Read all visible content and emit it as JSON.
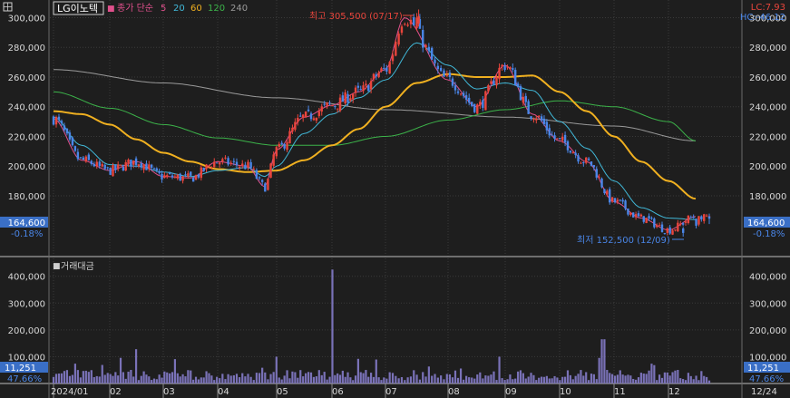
{
  "header": {
    "stock_name": "LG이노텍",
    "ma_label": "종가 단순",
    "ma_periods": [
      {
        "label": "5",
        "color": "#e0508c"
      },
      {
        "label": "20",
        "color": "#41b8d8"
      },
      {
        "label": "60",
        "color": "#f0b020"
      },
      {
        "label": "120",
        "color": "#3cb34a"
      },
      {
        "label": "240",
        "color": "#9a9a9a"
      }
    ],
    "lc": "LC:7.93",
    "hc": "HC:-46.12"
  },
  "price_panel": {
    "current_price": "164,600",
    "change_pct": "-0.18%",
    "high_annotation": "최고 305,500 (07/17)",
    "low_annotation": "최저 152,500 (12/09)"
  },
  "volume_panel": {
    "label": "거래대금",
    "current_value": "11,251",
    "change_pct": "47.66%"
  },
  "colors": {
    "background": "#1e1e1e",
    "up": "#e8453c",
    "down": "#4a86e8",
    "volume_bar": "#7a72b8",
    "badge": "#3a6fc6"
  },
  "chart_data": [
    {
      "type": "line",
      "title": "LG이노텍",
      "x_labels": [
        "2024/01",
        "02",
        "03",
        "04",
        "05",
        "06",
        "07",
        "08",
        "09",
        "10",
        "11",
        "12",
        "12/24"
      ],
      "y_ticks": [
        180000,
        200000,
        220000,
        240000,
        260000,
        280000,
        300000
      ],
      "ylim": [
        147000,
        307000
      ],
      "close_anchors": [
        {
          "x": "2024/01",
          "y": 234000
        },
        {
          "x": "01-mid",
          "y": 210000
        },
        {
          "x": "02",
          "y": 195000
        },
        {
          "x": "02-mid",
          "y": 204000
        },
        {
          "x": "03",
          "y": 192000
        },
        {
          "x": "03-mid",
          "y": 191000
        },
        {
          "x": "04",
          "y": 205000
        },
        {
          "x": "04-mid",
          "y": 199000
        },
        {
          "x": "04-end",
          "y": 184000
        },
        {
          "x": "05",
          "y": 212000
        },
        {
          "x": "05-mid",
          "y": 236000
        },
        {
          "x": "06",
          "y": 242000
        },
        {
          "x": "06-mid",
          "y": 252000
        },
        {
          "x": "07",
          "y": 268000
        },
        {
          "x": "07/17",
          "y": 305500
        },
        {
          "x": "08",
          "y": 262000
        },
        {
          "x": "08-mid",
          "y": 237000
        },
        {
          "x": "08-end",
          "y": 258000
        },
        {
          "x": "09",
          "y": 278000
        },
        {
          "x": "09-mid",
          "y": 232000
        },
        {
          "x": "10",
          "y": 216000
        },
        {
          "x": "10-mid",
          "y": 203000
        },
        {
          "x": "11",
          "y": 173000
        },
        {
          "x": "11-mid",
          "y": 164000
        },
        {
          "x": "12/09",
          "y": 152500
        },
        {
          "x": "12/24",
          "y": 164600
        }
      ],
      "series": [
        {
          "name": "5",
          "anchors": [
            [
              0,
              232000
            ],
            [
              0.5,
              204000
            ],
            [
              1,
              197000
            ],
            [
              1.5,
              203000
            ],
            [
              2,
              193000
            ],
            [
              2.5,
              192000
            ],
            [
              3,
              203000
            ],
            [
              3.5,
              200000
            ],
            [
              3.8,
              186000
            ],
            [
              4,
              211000
            ],
            [
              4.5,
              233000
            ],
            [
              5,
              241000
            ],
            [
              5.5,
              250000
            ],
            [
              6,
              265000
            ],
            [
              6.3,
              300000
            ],
            [
              7,
              258000
            ],
            [
              7.5,
              240000
            ],
            [
              8,
              268000
            ],
            [
              8.5,
              235000
            ],
            [
              9,
              217000
            ],
            [
              9.5,
              203000
            ],
            [
              10,
              176000
            ],
            [
              10.5,
              165000
            ],
            [
              11,
              157000
            ],
            [
              11.5,
              166000
            ]
          ]
        },
        {
          "name": "20",
          "anchors": [
            [
              0,
              233000
            ],
            [
              0.5,
              214000
            ],
            [
              1,
              201000
            ],
            [
              1.5,
              200000
            ],
            [
              2,
              196000
            ],
            [
              2.5,
              193000
            ],
            [
              3,
              197000
            ],
            [
              3.5,
              199000
            ],
            [
              3.8,
              193000
            ],
            [
              4,
              200000
            ],
            [
              4.5,
              222000
            ],
            [
              5,
              235000
            ],
            [
              5.5,
              246000
            ],
            [
              6,
              258000
            ],
            [
              6.5,
              283000
            ],
            [
              7,
              268000
            ],
            [
              7.5,
              252000
            ],
            [
              8,
              256000
            ],
            [
              8.5,
              251000
            ],
            [
              9,
              230000
            ],
            [
              9.5,
              212000
            ],
            [
              10,
              190000
            ],
            [
              10.5,
              172000
            ],
            [
              11,
              165000
            ],
            [
              11.5,
              164000
            ]
          ]
        },
        {
          "name": "60",
          "anchors": [
            [
              0,
              237000
            ],
            [
              0.5,
              235000
            ],
            [
              1,
              228000
            ],
            [
              1.5,
              218000
            ],
            [
              2,
              209000
            ],
            [
              2.5,
              203000
            ],
            [
              3,
              198000
            ],
            [
              3.5,
              196000
            ],
            [
              4,
              197000
            ],
            [
              4.5,
              204000
            ],
            [
              5,
              214000
            ],
            [
              5.5,
              225000
            ],
            [
              6,
              240000
            ],
            [
              6.5,
              256000
            ],
            [
              7,
              262000
            ],
            [
              7.5,
              260000
            ],
            [
              8,
              260000
            ],
            [
              8.5,
              261000
            ],
            [
              9,
              250000
            ],
            [
              9.5,
              237000
            ],
            [
              10,
              220000
            ],
            [
              10.5,
              203000
            ],
            [
              11,
              190000
            ],
            [
              11.5,
              178000
            ]
          ]
        },
        {
          "name": "120",
          "anchors": [
            [
              0,
              250000
            ],
            [
              1,
              239000
            ],
            [
              2,
              228000
            ],
            [
              3,
              219000
            ],
            [
              4,
              214000
            ],
            [
              5,
              214000
            ],
            [
              6,
              220000
            ],
            [
              7,
              231000
            ],
            [
              8,
              238000
            ],
            [
              9,
              244000
            ],
            [
              10,
              240000
            ],
            [
              11,
              230000
            ],
            [
              11.5,
              217000
            ]
          ]
        },
        {
          "name": "240",
          "anchors": [
            [
              0,
              265000
            ],
            [
              2,
              256000
            ],
            [
              4,
              246000
            ],
            [
              6,
              238000
            ],
            [
              8,
              233000
            ],
            [
              10,
              227000
            ],
            [
              11.5,
              217000
            ]
          ]
        }
      ]
    },
    {
      "type": "bar",
      "title": "거래대금",
      "y_ticks": [
        100000,
        200000,
        300000,
        400000
      ],
      "ylim": [
        0,
        470000
      ],
      "spikes": [
        {
          "x": "02-mid",
          "y": 128000
        },
        {
          "x": "05",
          "y": 100000
        },
        {
          "x": "06",
          "y": 425000
        },
        {
          "x": "06-mid",
          "y": 92000
        },
        {
          "x": "10-end",
          "y": 165000
        }
      ],
      "typical_value": 35000,
      "last_value": 11251
    }
  ]
}
